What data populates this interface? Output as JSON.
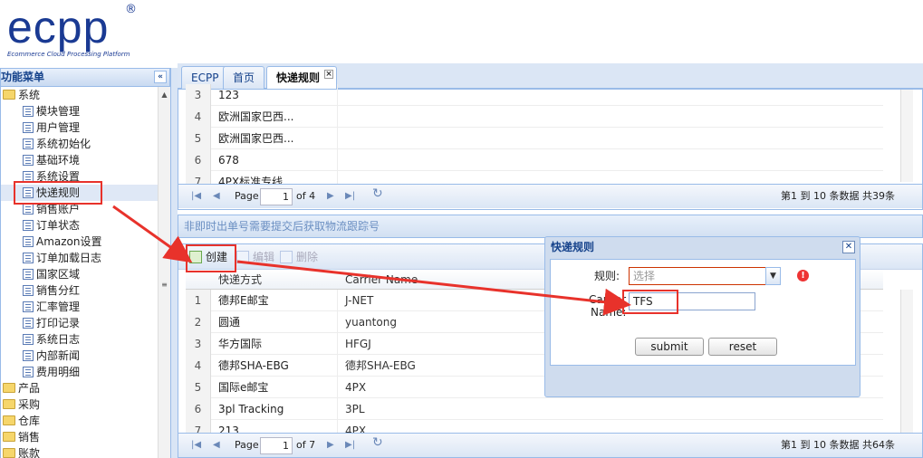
{
  "logo": {
    "text": "ecpp",
    "registered": "®",
    "subtitle": "Ecommerce Cloud Processing Platform"
  },
  "left_panel": {
    "title": "功能菜单",
    "collapse_glyph": "«",
    "tree": [
      {
        "label": "系统",
        "type": "folder",
        "level": 0
      },
      {
        "label": "模块管理",
        "type": "leaf",
        "level": 1
      },
      {
        "label": "用户管理",
        "type": "leaf",
        "level": 1
      },
      {
        "label": "系统初始化",
        "type": "leaf",
        "level": 1
      },
      {
        "label": "基础环境",
        "type": "leaf",
        "level": 1
      },
      {
        "label": "系统设置",
        "type": "leaf",
        "level": 1
      },
      {
        "label": "快递规则",
        "type": "leaf",
        "level": 1,
        "selected": true
      },
      {
        "label": "销售账户",
        "type": "leaf",
        "level": 1
      },
      {
        "label": "订单状态",
        "type": "leaf",
        "level": 1
      },
      {
        "label": "Amazon设置",
        "type": "leaf",
        "level": 1
      },
      {
        "label": "订单加载日志",
        "type": "leaf",
        "level": 1
      },
      {
        "label": "国家区域",
        "type": "leaf",
        "level": 1
      },
      {
        "label": "销售分红",
        "type": "leaf",
        "level": 1
      },
      {
        "label": "汇率管理",
        "type": "leaf",
        "level": 1
      },
      {
        "label": "打印记录",
        "type": "leaf",
        "level": 1
      },
      {
        "label": "系统日志",
        "type": "leaf",
        "level": 1
      },
      {
        "label": "内部新闻",
        "type": "leaf",
        "level": 1
      },
      {
        "label": "费用明细",
        "type": "leaf",
        "level": 1
      },
      {
        "label": "产品",
        "type": "folder",
        "level": 0
      },
      {
        "label": "采购",
        "type": "folder",
        "level": 0
      },
      {
        "label": "仓库",
        "type": "folder",
        "level": 0
      },
      {
        "label": "销售",
        "type": "folder",
        "level": 0
      },
      {
        "label": "账款",
        "type": "folder",
        "level": 0
      }
    ]
  },
  "tabs": [
    {
      "label": "ECPP",
      "active": false
    },
    {
      "label": "首页",
      "active": false
    },
    {
      "label": "快递规则",
      "active": true,
      "closable": true
    }
  ],
  "top_grid": {
    "rows": [
      {
        "n": "3",
        "name": "123"
      },
      {
        "n": "4",
        "name": "欧洲国家巴西..."
      },
      {
        "n": "5",
        "name": "欧洲国家巴西..."
      },
      {
        "n": "6",
        "name": "678"
      },
      {
        "n": "7",
        "name": "4PX标准专线"
      }
    ],
    "pager": {
      "page_label": "Page",
      "page": "1",
      "of": "of 4",
      "summary": "第1 到 10 条数据 共39条"
    }
  },
  "bottom_section": {
    "title": "非即时出单号需要提交后获取物流跟踪号",
    "toolbar": {
      "create": "创建",
      "edit": "编辑",
      "delete": "删除"
    },
    "columns": [
      "快递方式",
      "Carrier Name"
    ],
    "rows": [
      {
        "n": "1",
        "name": "德邦E邮宝",
        "carrier": "J-NET"
      },
      {
        "n": "2",
        "name": "圆通",
        "carrier": "yuantong"
      },
      {
        "n": "3",
        "name": "华方国际",
        "carrier": "HFGJ"
      },
      {
        "n": "4",
        "name": "德邦SHA-EBG",
        "carrier": "德邦SHA-EBG"
      },
      {
        "n": "5",
        "name": "国际e邮宝",
        "carrier": "4PX"
      },
      {
        "n": "6",
        "name": "3pl Tracking",
        "carrier": "3PL"
      },
      {
        "n": "7",
        "name": "213",
        "carrier": "4PX"
      }
    ],
    "pager": {
      "page_label": "Page",
      "page": "1",
      "of": "of 7",
      "summary": "第1 到 10 条数据 共64条"
    }
  },
  "dialog": {
    "title": "快递规则",
    "close_glyph": "✕",
    "rule_label": "规则:",
    "rule_placeholder": "选择",
    "carrier_label_1": "Carrier",
    "carrier_label_2": "Name:",
    "carrier_value": "TFS",
    "submit": "submit",
    "reset": "reset",
    "warn_glyph": "!"
  },
  "colors": {
    "accent": "#15428b",
    "border": "#99bbe8",
    "annotation": "#e8322b"
  }
}
